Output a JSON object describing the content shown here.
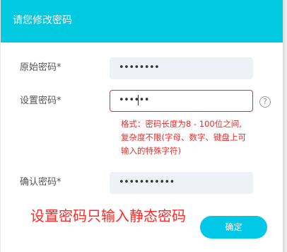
{
  "dialog": {
    "title": "请您修改密码"
  },
  "form": {
    "original_password": {
      "label": "原始密码*",
      "masked_value": "••••••••"
    },
    "new_password": {
      "label": "设置密码*",
      "masked_value": "••••••",
      "help_icon": "question-circle-icon",
      "error_lines": [
        "格式：密码长度为8 - 100位之间,",
        "复杂度不限(字母、数字、键盘上可",
        "输入的特殊字符)"
      ]
    },
    "confirm_password": {
      "label": "确认密码*",
      "masked_value": "•••••••••••"
    }
  },
  "annotation": {
    "text": "设置密码只输入静态密码"
  },
  "actions": {
    "confirm_label": "确定"
  },
  "colors": {
    "header": "#00c9e0",
    "accent_button": "#00c8e6",
    "error": "#e0302e",
    "annotation": "#ff2a2a",
    "field_bg": "#eef1f5"
  }
}
